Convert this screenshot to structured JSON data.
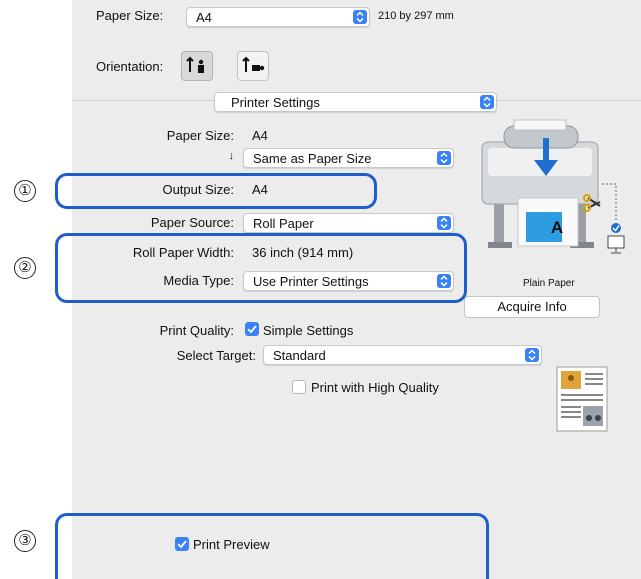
{
  "paper_size": {
    "label": "Paper Size:",
    "value": "A4",
    "dimensions": "210 by 297 mm"
  },
  "orientation": {
    "label": "Orientation:"
  },
  "printer_settings_popup": {
    "value": "Printer Settings"
  },
  "settings": {
    "paper_size_label": "Paper Size:",
    "paper_size_value": "A4",
    "scale_arrow": "↓",
    "scale_value": "Same as Paper Size",
    "output_size_label": "Output Size:",
    "output_size_value": "A4",
    "paper_source_label": "Paper Source:",
    "paper_source_value": "Roll Paper",
    "roll_width_label": "Roll Paper Width:",
    "roll_width_value": "36 inch (914 mm)",
    "media_type_label": "Media Type:",
    "media_type_value": "Use Printer Settings"
  },
  "printer_image": {
    "caption": "Plain Paper",
    "sheet_letter": "A"
  },
  "acquire_info_button": "Acquire Info",
  "print_quality": {
    "label": "Print Quality:",
    "simple_settings_label": "Simple Settings",
    "simple_settings_checked": true,
    "select_target_label": "Select Target:",
    "select_target_value": "Standard",
    "high_quality_label": "Print with High Quality",
    "high_quality_checked": false
  },
  "print_preview": {
    "label": "Print Preview",
    "checked": true
  },
  "callouts": [
    "①",
    "②",
    "③"
  ],
  "colors": {
    "accent": "#3b82f6",
    "highlight": "#1f5ec9",
    "panel": "#ececec"
  }
}
